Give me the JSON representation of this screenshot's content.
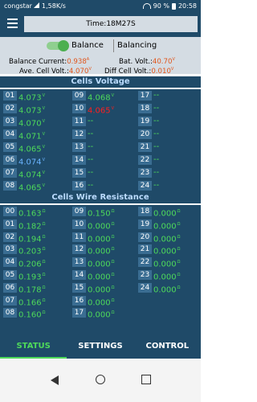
{
  "status_bar": {
    "carrier": "congstar",
    "speed": "1,58K/s",
    "battery": "90 %",
    "time": "20:58"
  },
  "header": {
    "time_label": "Time:18M27S"
  },
  "balance": {
    "toggle_label": "Balance",
    "toggle_on": true,
    "status": "Balancing"
  },
  "info": {
    "balance_current_label": "Balance Current:",
    "balance_current_value": "0.938",
    "balance_current_unit": "A",
    "bat_volt_label": "Bat. Volt.:",
    "bat_volt_value": "40.70",
    "bat_volt_unit": "V",
    "ave_cell_label": "Ave. Cell Volt.:",
    "ave_cell_value": "4.070",
    "ave_cell_unit": "V",
    "diff_cell_label": "Diff Cell Volt.:",
    "diff_cell_value": "0.010",
    "diff_cell_unit": "V"
  },
  "voltage": {
    "title": "Cells Voltage",
    "unit": "V",
    "col1": [
      {
        "idx": "01",
        "val": "4.073"
      },
      {
        "idx": "02",
        "val": "4.073"
      },
      {
        "idx": "03",
        "val": "4.070"
      },
      {
        "idx": "04",
        "val": "4.071"
      },
      {
        "idx": "05",
        "val": "4.065"
      },
      {
        "idx": "06",
        "val": "4.074"
      },
      {
        "idx": "07",
        "val": "4.074"
      },
      {
        "idx": "08",
        "val": "4.065"
      }
    ],
    "col2": [
      {
        "idx": "09",
        "val": "4.068"
      },
      {
        "idx": "10",
        "val": "4.065"
      },
      {
        "idx": "11",
        "val": "--"
      },
      {
        "idx": "12",
        "val": "--"
      },
      {
        "idx": "13",
        "val": "--"
      },
      {
        "idx": "14",
        "val": "--"
      },
      {
        "idx": "15",
        "val": "--"
      },
      {
        "idx": "16",
        "val": "--"
      }
    ],
    "col3": [
      {
        "idx": "17",
        "val": "--"
      },
      {
        "idx": "18",
        "val": "--"
      },
      {
        "idx": "19",
        "val": "--"
      },
      {
        "idx": "20",
        "val": "--"
      },
      {
        "idx": "21",
        "val": "--"
      },
      {
        "idx": "22",
        "val": "--"
      },
      {
        "idx": "23",
        "val": "--"
      },
      {
        "idx": "24",
        "val": "--"
      }
    ]
  },
  "resistance": {
    "title": "Cells Wire Resistance",
    "unit": "Ω",
    "col1": [
      {
        "idx": "00",
        "val": "0.163"
      },
      {
        "idx": "01",
        "val": "0.182"
      },
      {
        "idx": "02",
        "val": "0.194"
      },
      {
        "idx": "03",
        "val": "0.203"
      },
      {
        "idx": "04",
        "val": "0.206"
      },
      {
        "idx": "05",
        "val": "0.193"
      },
      {
        "idx": "06",
        "val": "0.178"
      },
      {
        "idx": "07",
        "val": "0.166"
      },
      {
        "idx": "08",
        "val": "0.160"
      }
    ],
    "col2": [
      {
        "idx": "09",
        "val": "0.150"
      },
      {
        "idx": "10",
        "val": "0.000"
      },
      {
        "idx": "11",
        "val": "0.000"
      },
      {
        "idx": "12",
        "val": "0.000"
      },
      {
        "idx": "13",
        "val": "0.000"
      },
      {
        "idx": "14",
        "val": "0.000"
      },
      {
        "idx": "15",
        "val": "0.000"
      },
      {
        "idx": "16",
        "val": "0.000"
      },
      {
        "idx": "17",
        "val": "0.000"
      }
    ],
    "col3": [
      {
        "idx": "18",
        "val": "0.000"
      },
      {
        "idx": "19",
        "val": "0.000"
      },
      {
        "idx": "20",
        "val": "0.000"
      },
      {
        "idx": "21",
        "val": "0.000"
      },
      {
        "idx": "22",
        "val": "0.000"
      },
      {
        "idx": "23",
        "val": "0.000"
      },
      {
        "idx": "24",
        "val": "0.000"
      }
    ]
  },
  "tabs": [
    {
      "label": "STATUS",
      "active": true
    },
    {
      "label": "SETTINGS",
      "active": false
    },
    {
      "label": "CONTROL",
      "active": false
    }
  ],
  "nav_icons": [
    "back-icon",
    "home-icon",
    "recents-icon"
  ]
}
